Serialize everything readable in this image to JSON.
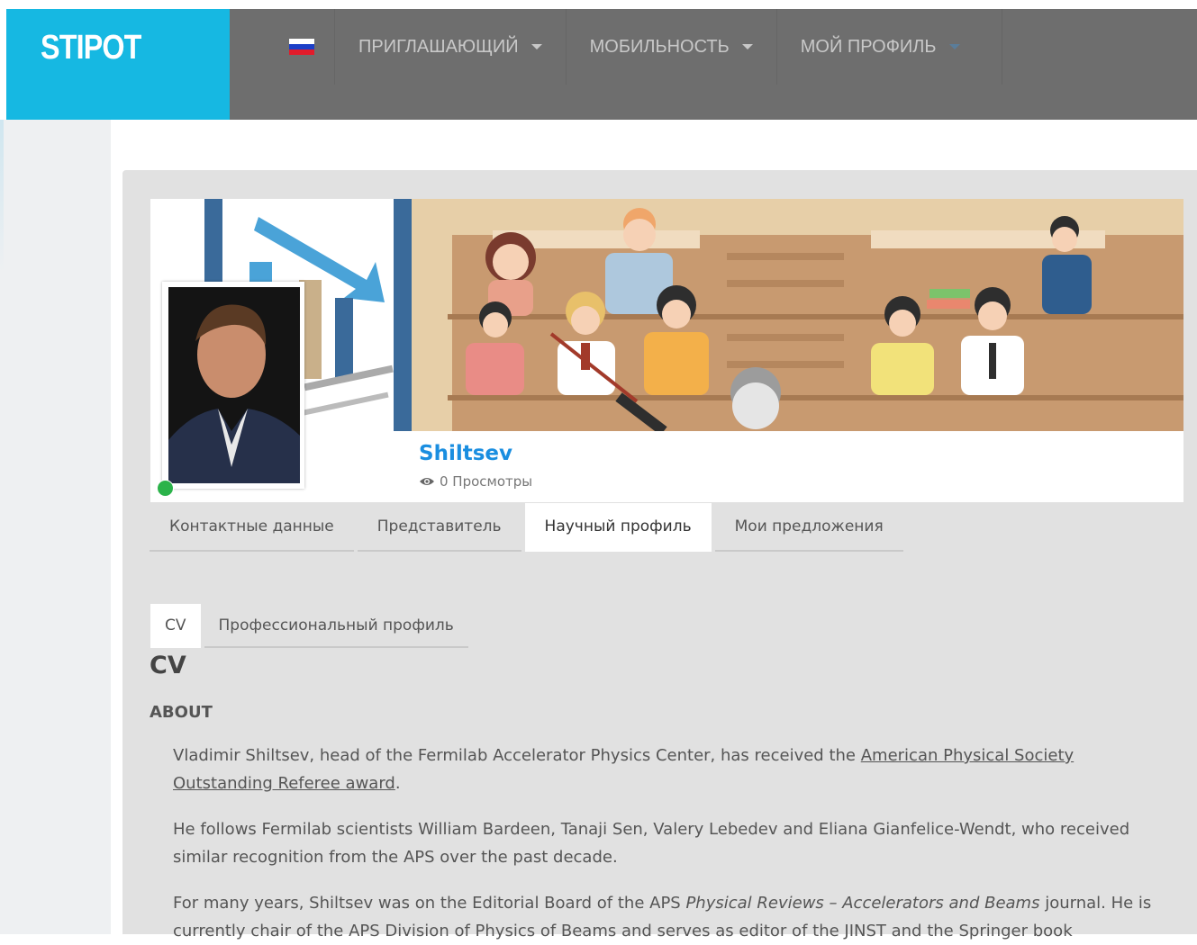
{
  "brand": {
    "logo_text": "STIPOT",
    "accent": "#16b8e2",
    "nav_bg": "#6e6e6e"
  },
  "nav": {
    "language_flag": "russia-flag-icon",
    "items": [
      {
        "label": "ПРИГЛАШАЮЩИЙ"
      },
      {
        "label": "МОБИЛЬНОСТЬ"
      },
      {
        "label": "МОЙ ПРОФИЛЬ"
      }
    ]
  },
  "profile": {
    "name": "Shiltsev",
    "views": "0 Просмотры",
    "status_color": "#2bb34a"
  },
  "tabs": [
    {
      "label": "Контактные данные"
    },
    {
      "label": "Представитель"
    },
    {
      "label": "Научный профиль"
    },
    {
      "label": "Мои предложения"
    }
  ],
  "subtabs": [
    {
      "label": "CV"
    },
    {
      "label": "Профессиональный профиль"
    }
  ],
  "content": {
    "heading": "CV",
    "section_title": "ABOUT",
    "p1_before": "Vladimir Shiltsev, head of the Fermilab Accelerator Physics Center, has received the ",
    "p1_link": "American Physical Society Outstanding Referee award",
    "p1_after": ".",
    "p2": "He follows Fermilab scientists William Bardeen, Tanaji Sen, Valery Lebedev and Eliana Gianfelice-Wendt, who received similar recognition from the APS over the past decade.",
    "p3_before": "For many years, Shiltsev was on the Editorial Board of the APS ",
    "p3_italic": "Physical Reviews – Accelerators and Beams",
    "p3_after": " journal. He is currently chair of the APS Division of Physics of Beams and serves as editor of the JINST and the Springer book"
  }
}
